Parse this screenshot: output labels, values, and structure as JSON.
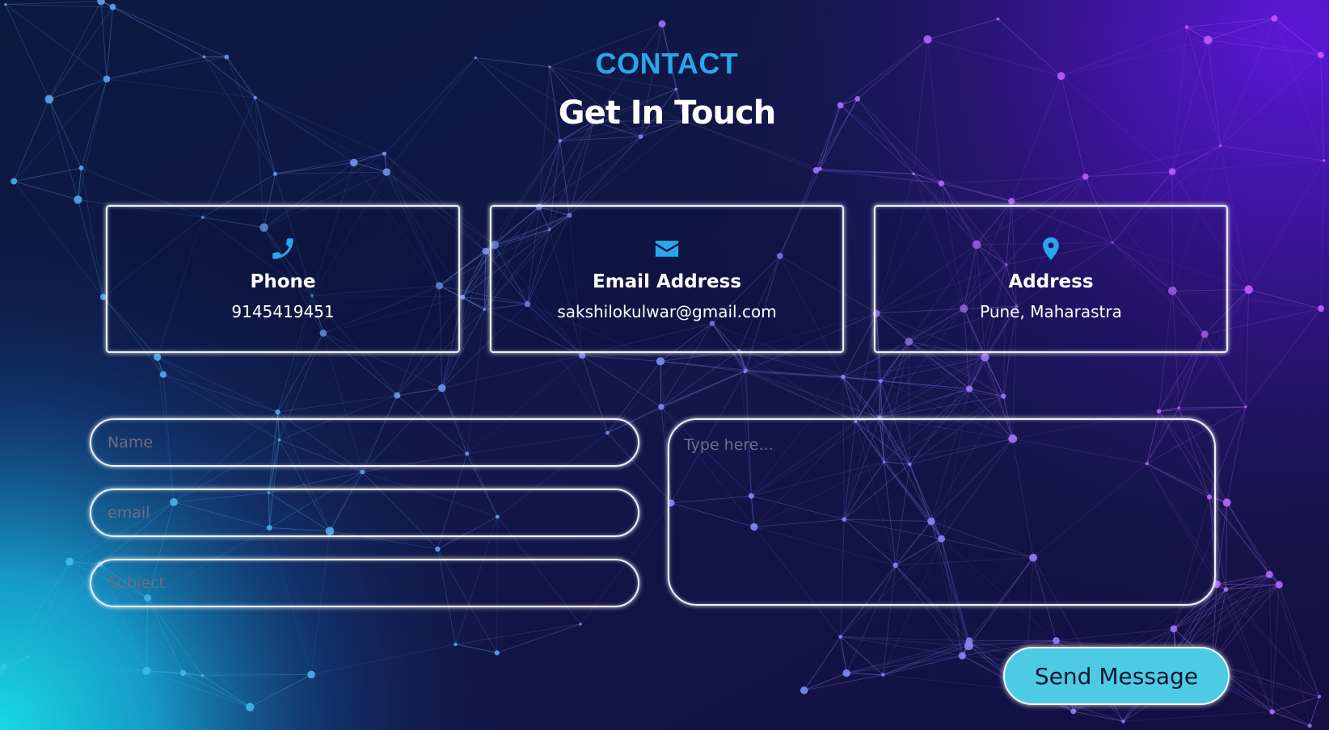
{
  "header": {
    "label": "CONTACT",
    "title": "Get In Touch"
  },
  "cards": [
    {
      "icon": "phone-icon",
      "title": "Phone",
      "value": "9145419451"
    },
    {
      "icon": "envelope-icon",
      "title": "Email Address",
      "value": "sakshilokulwar@gmail.com"
    },
    {
      "icon": "map-pin-icon",
      "title": "Address",
      "value": "Pune, Maharastra"
    }
  ],
  "form": {
    "name_placeholder": "Name",
    "email_placeholder": "email",
    "subject_placeholder": "Subject",
    "message_placeholder": "Type here...",
    "send_label": "Send Message"
  },
  "colors": {
    "accent": "#2aa7ea",
    "button": "#4ccbe2",
    "background_dark": "#0f1640",
    "background_purple": "#4a1bb5",
    "background_cyan": "#1ad4e0"
  }
}
